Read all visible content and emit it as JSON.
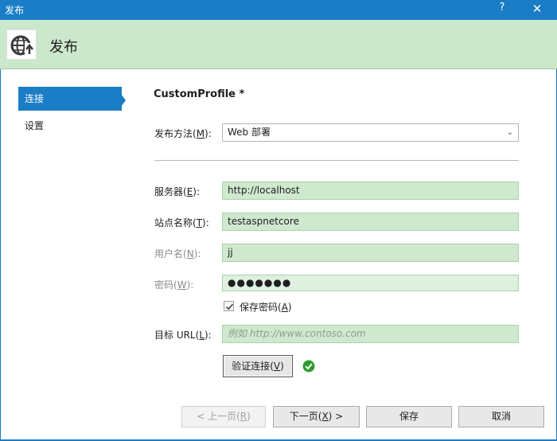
{
  "window": {
    "title": "发布",
    "help_label": "?",
    "close_label": "✕"
  },
  "header": {
    "title": "发布",
    "logo_icon": "globe-publish-icon"
  },
  "sidebar": {
    "items": [
      {
        "label": "连接",
        "active": true
      },
      {
        "label": "设置",
        "active": false
      }
    ]
  },
  "profile": {
    "name": "CustomProfile *"
  },
  "form": {
    "publish_method": {
      "label": "发布方法(",
      "key": "M",
      "suffix": "):",
      "value": "Web 部署"
    },
    "server": {
      "label": "服务器(",
      "key": "E",
      "suffix": "):",
      "value": "http://localhost"
    },
    "site_name": {
      "label": "站点名称(",
      "key": "T",
      "suffix": "):",
      "value": "testaspnetcore"
    },
    "username": {
      "label": "用户名(",
      "key": "N",
      "suffix": "):",
      "value": "jj"
    },
    "password": {
      "label": "密码(",
      "key": "W",
      "suffix": "):",
      "value": "●●●●●●●"
    },
    "save_password": {
      "label": "保存密码(",
      "key": "A",
      "suffix": ")",
      "checked": true
    },
    "target_url": {
      "label": "目标 URL(",
      "key": "L",
      "suffix": "):",
      "placeholder": "例如 http://www.contoso.com"
    },
    "validate_button": {
      "label": "验证连接(",
      "key": "V",
      "suffix": ")"
    },
    "validation_status_icon": "check-circle-icon"
  },
  "footer": {
    "back": {
      "label": "< 上一页(",
      "key": "R",
      "suffix": ")",
      "enabled": false
    },
    "next": {
      "label": "下一页(",
      "key": "X",
      "suffix": ") >",
      "enabled": true
    },
    "save": {
      "label": "保存"
    },
    "cancel": {
      "label": "取消"
    }
  },
  "colors": {
    "accent": "#1a7dc6",
    "header_bg": "#cce8cc",
    "field_bg": "#cfe9cf",
    "success": "#2e9d2e"
  }
}
